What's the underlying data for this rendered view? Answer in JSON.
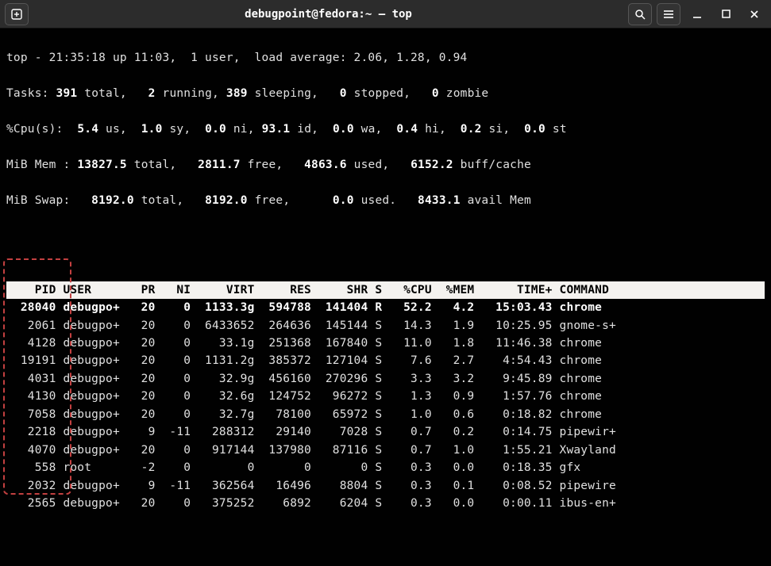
{
  "window": {
    "title": "debugpoint@fedora:~ — top"
  },
  "summary": {
    "line1": "top - 21:35:18 up 11:03,  1 user,  load average: 2.06, 1.28, 0.94",
    "tasks_label": "Tasks:",
    "tasks_total": "391",
    "tasks_total_txt": " total,",
    "tasks_running": "2",
    "tasks_running_txt": " running,",
    "tasks_sleeping": "389",
    "tasks_sleeping_txt": " sleeping,",
    "tasks_stopped": "0",
    "tasks_stopped_txt": " stopped,",
    "tasks_zombie": "0",
    "tasks_zombie_txt": " zombie",
    "cpu_label": "%Cpu(s):",
    "cpu_us": "5.4",
    "cpu_us_txt": " us,",
    "cpu_sy": "1.0",
    "cpu_sy_txt": " sy,",
    "cpu_ni": "0.0",
    "cpu_ni_txt": " ni,",
    "cpu_id": "93.1",
    "cpu_id_txt": " id,",
    "cpu_wa": "0.0",
    "cpu_wa_txt": " wa,",
    "cpu_hi": "0.4",
    "cpu_hi_txt": " hi,",
    "cpu_si": "0.2",
    "cpu_si_txt": " si,",
    "cpu_st": "0.0",
    "cpu_st_txt": " st",
    "mem_label": "MiB Mem :",
    "mem_total": "13827.5",
    "mem_total_txt": " total,",
    "mem_free": "2811.7",
    "mem_free_txt": " free,",
    "mem_used": "4863.6",
    "mem_used_txt": " used,",
    "mem_buff": "6152.2",
    "mem_buff_txt": " buff/cache",
    "swap_label": "MiB Swap:",
    "swap_total": "8192.0",
    "swap_total_txt": " total,",
    "swap_free": "8192.0",
    "swap_free_txt": " free,",
    "swap_used": "0.0",
    "swap_used_txt": " used.",
    "swap_avail": "8433.1",
    "swap_avail_txt": " avail Mem"
  },
  "columns": [
    "PID",
    "USER",
    "PR",
    "NI",
    "VIRT",
    "RES",
    "SHR",
    "S",
    "%CPU",
    "%MEM",
    "TIME+",
    "COMMAND"
  ],
  "rows": [
    {
      "pid": "28040",
      "user": "debugpo+",
      "pr": "20",
      "ni": "0",
      "virt": "1133.3g",
      "res": "594788",
      "shr": "141404",
      "s": "R",
      "cpu": "52.2",
      "mem": "4.2",
      "time": "15:03.43",
      "cmd": "chrome",
      "bold": true
    },
    {
      "pid": "2061",
      "user": "debugpo+",
      "pr": "20",
      "ni": "0",
      "virt": "6433652",
      "res": "264636",
      "shr": "145144",
      "s": "S",
      "cpu": "14.3",
      "mem": "1.9",
      "time": "10:25.95",
      "cmd": "gnome-s+"
    },
    {
      "pid": "4128",
      "user": "debugpo+",
      "pr": "20",
      "ni": "0",
      "virt": "33.1g",
      "res": "251368",
      "shr": "167840",
      "s": "S",
      "cpu": "11.0",
      "mem": "1.8",
      "time": "11:46.38",
      "cmd": "chrome"
    },
    {
      "pid": "19191",
      "user": "debugpo+",
      "pr": "20",
      "ni": "0",
      "virt": "1131.2g",
      "res": "385372",
      "shr": "127104",
      "s": "S",
      "cpu": "7.6",
      "mem": "2.7",
      "time": "4:54.43",
      "cmd": "chrome"
    },
    {
      "pid": "4031",
      "user": "debugpo+",
      "pr": "20",
      "ni": "0",
      "virt": "32.9g",
      "res": "456160",
      "shr": "270296",
      "s": "S",
      "cpu": "3.3",
      "mem": "3.2",
      "time": "9:45.89",
      "cmd": "chrome"
    },
    {
      "pid": "4130",
      "user": "debugpo+",
      "pr": "20",
      "ni": "0",
      "virt": "32.6g",
      "res": "124752",
      "shr": "96272",
      "s": "S",
      "cpu": "1.3",
      "mem": "0.9",
      "time": "1:57.76",
      "cmd": "chrome"
    },
    {
      "pid": "7058",
      "user": "debugpo+",
      "pr": "20",
      "ni": "0",
      "virt": "32.7g",
      "res": "78100",
      "shr": "65972",
      "s": "S",
      "cpu": "1.0",
      "mem": "0.6",
      "time": "0:18.82",
      "cmd": "chrome"
    },
    {
      "pid": "2218",
      "user": "debugpo+",
      "pr": "9",
      "ni": "-11",
      "virt": "288312",
      "res": "29140",
      "shr": "7028",
      "s": "S",
      "cpu": "0.7",
      "mem": "0.2",
      "time": "0:14.75",
      "cmd": "pipewir+"
    },
    {
      "pid": "4070",
      "user": "debugpo+",
      "pr": "20",
      "ni": "0",
      "virt": "917144",
      "res": "137980",
      "shr": "87116",
      "s": "S",
      "cpu": "0.7",
      "mem": "1.0",
      "time": "1:55.21",
      "cmd": "Xwayland"
    },
    {
      "pid": "558",
      "user": "root",
      "pr": "-2",
      "ni": "0",
      "virt": "0",
      "res": "0",
      "shr": "0",
      "s": "S",
      "cpu": "0.3",
      "mem": "0.0",
      "time": "0:18.35",
      "cmd": "gfx"
    },
    {
      "pid": "2032",
      "user": "debugpo+",
      "pr": "9",
      "ni": "-11",
      "virt": "362564",
      "res": "16496",
      "shr": "8804",
      "s": "S",
      "cpu": "0.3",
      "mem": "0.1",
      "time": "0:08.52",
      "cmd": "pipewire"
    },
    {
      "pid": "2565",
      "user": "debugpo+",
      "pr": "20",
      "ni": "0",
      "virt": "375252",
      "res": "6892",
      "shr": "6204",
      "s": "S",
      "cpu": "0.3",
      "mem": "0.0",
      "time": "0:00.11",
      "cmd": "ibus-en+"
    }
  ]
}
